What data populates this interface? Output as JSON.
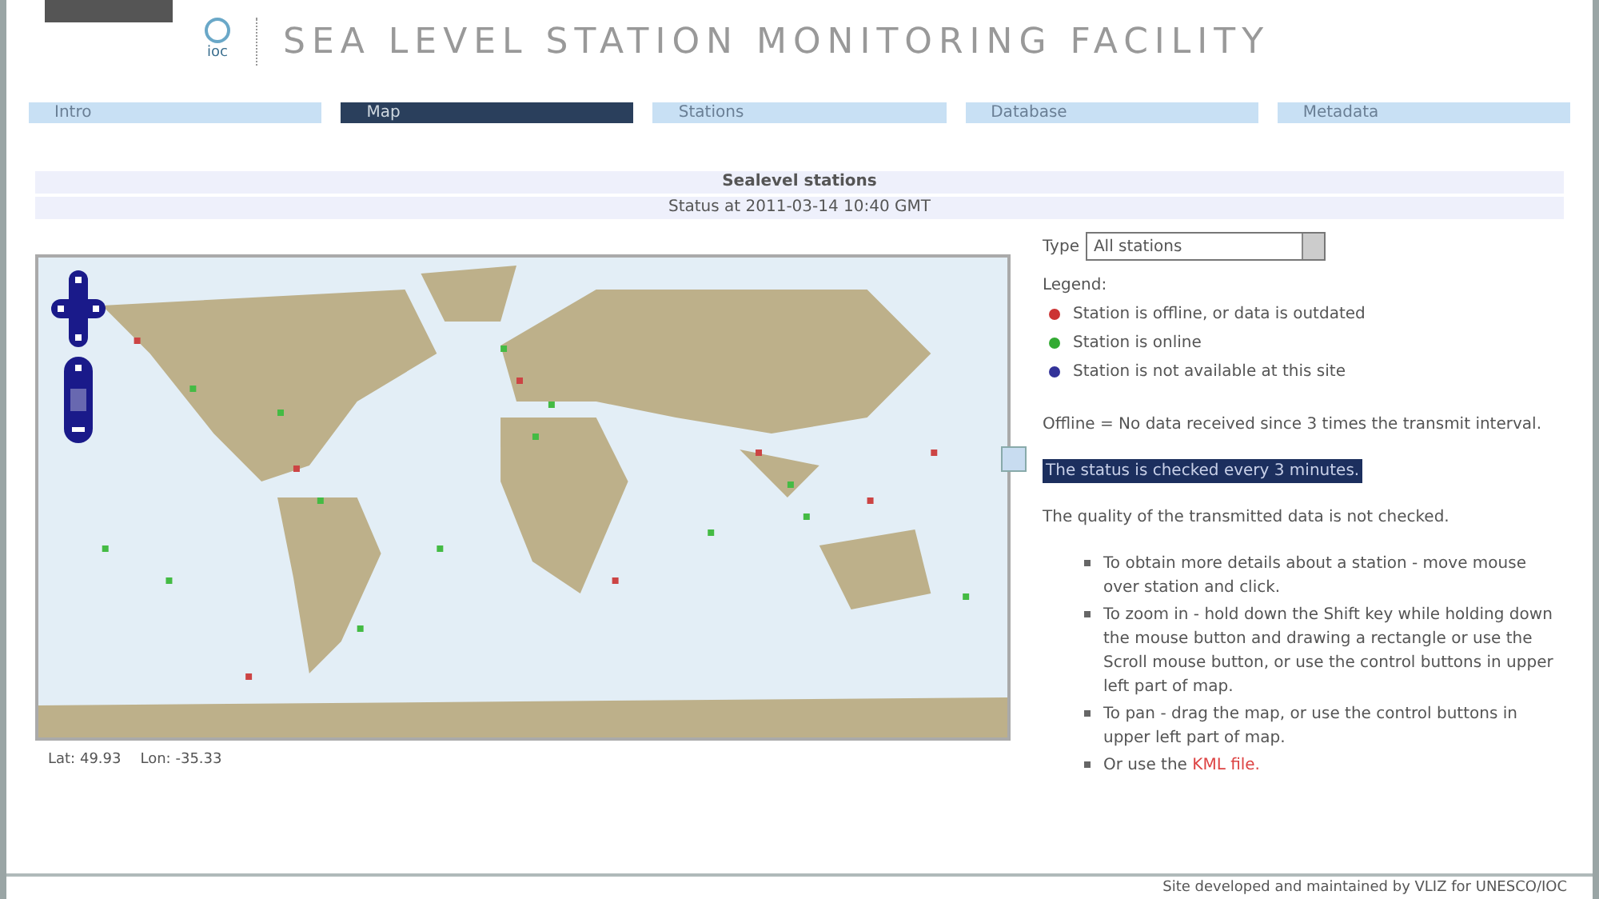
{
  "header": {
    "title": "SEA LEVEL STATION MONITORING FACILITY",
    "logo_text": "ioc"
  },
  "tabs": [
    {
      "label": "Intro",
      "selected": false
    },
    {
      "label": "Map",
      "selected": true
    },
    {
      "label": "Stations",
      "selected": false
    },
    {
      "label": "Database",
      "selected": false
    },
    {
      "label": "Metadata",
      "selected": false
    }
  ],
  "heading": "Sealevel stations",
  "status": "Status at 2011-03-14 10:40 GMT",
  "map": {
    "kind": "picture",
    "coordinates": [
      {
        "label": "Lat:",
        "value": "49.93"
      },
      {
        "label": "Lon:",
        "value": "-35.33"
      }
    ]
  },
  "type_select": {
    "label": "Type",
    "value": "All stations"
  },
  "legend": {
    "title": "Legend:",
    "items": [
      {
        "label": "Station is offline, or data is outdated",
        "color": "#cc3333"
      },
      {
        "label": "Station is online",
        "color": "#33aa33"
      },
      {
        "label": "Station is not available at this site",
        "color": "#333399"
      }
    ]
  },
  "offline_note": "Offline = No data received since 3 times the transmit interval.",
  "check_note": "The status is checked every 3 minutes.",
  "quality_note": "The quality of the transmitted data is not checked.",
  "tips": [
    {
      "text": "To obtain more details about a station - move mouse over station and click."
    },
    {
      "text": "To zoom in - hold down the Shift key while holding down the mouse button and drawing a rectangle or use the Scroll mouse button, or use the control buttons in upper left part of map."
    },
    {
      "text": "To pan - drag the map, or use the control buttons in upper left part of map."
    },
    {
      "text": "Or use the ",
      "link": "KML file."
    }
  ],
  "footer": "Site developed and maintained by VLIZ for UNESCO/IOC"
}
